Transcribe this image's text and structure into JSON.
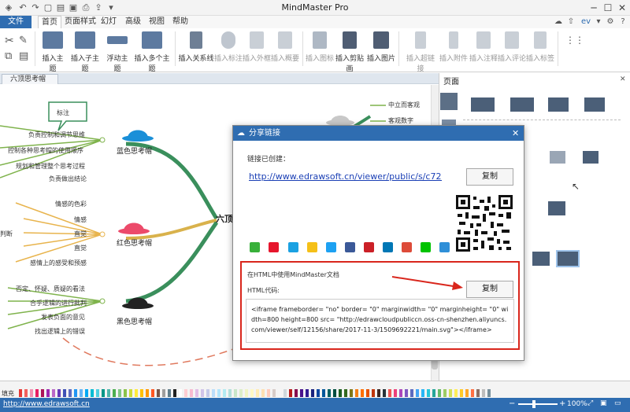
{
  "app": {
    "title": "MindMaster Pro",
    "account": "ev"
  },
  "menu": {
    "file": "文件",
    "tabs": [
      "首页",
      "页面样式",
      "幻灯片",
      "高级",
      "视图",
      "帮助"
    ]
  },
  "ribbon": {
    "buttons": [
      {
        "label": "插入主题"
      },
      {
        "label": "插入子主题"
      },
      {
        "label": "浮动主题"
      },
      {
        "label": "插入多个主题"
      },
      {
        "label": "插入关系线"
      },
      {
        "label": "插入标注"
      },
      {
        "label": "插入外框"
      },
      {
        "label": "插入概要"
      },
      {
        "label": "插入图标"
      },
      {
        "label": "插入剪贴画"
      },
      {
        "label": "插入图片"
      },
      {
        "label": "插入超链接"
      },
      {
        "label": "插入附件"
      },
      {
        "label": "插入注释"
      },
      {
        "label": "插入评论"
      },
      {
        "label": "插入标签"
      }
    ]
  },
  "document": {
    "tab_label": "六顶思考帽"
  },
  "mindmap": {
    "center": "六顶",
    "callout": "标注",
    "right_items": [
      "中立而客观",
      "客观数字"
    ],
    "blue_hat": {
      "label": "蓝色思考帽",
      "items": [
        "负责控制和调节思维",
        "控制各种思考帽的使用顺序",
        "规划和管理整个思考过程",
        "负责做出结论"
      ]
    },
    "red_hat": {
      "label": "红色思考帽",
      "side": "判断",
      "items": [
        "情感的色彩",
        "情感",
        "直觉",
        "直觉",
        "感情上的感受和预感"
      ]
    },
    "black_hat": {
      "label": "黑色思考帽",
      "items": [
        "否定、怀疑、质疑的看法",
        "合乎逻辑的进行批判",
        "发表负面的意见",
        "找出逻辑上的错误"
      ]
    }
  },
  "right_panel": {
    "title": "页面"
  },
  "palette": {
    "label": "填充",
    "colors": [
      "#e53935",
      "#f0605d",
      "#f48fb1",
      "#e91e63",
      "#ad1457",
      "#9c27b0",
      "#ba68c8",
      "#673ab7",
      "#3f51b5",
      "#5c6bc0",
      "#2196f3",
      "#64b5f6",
      "#03a9f4",
      "#00bcd4",
      "#4dd0e1",
      "#009688",
      "#4db6ac",
      "#4caf50",
      "#81c784",
      "#8bc34a",
      "#cddc39",
      "#ffeb3b",
      "#ffc107",
      "#ff9800",
      "#ff5722",
      "#795548",
      "#9e9e9e",
      "#607d8b",
      "#212121",
      "#ffffff",
      "#ffcdd2",
      "#f8bbd0",
      "#e1bee7",
      "#d1c4e9",
      "#c5cae9",
      "#bbdefb",
      "#b3e5fc",
      "#b2ebf2",
      "#b2dfdb",
      "#c8e6c9",
      "#dcedc8",
      "#f0f4c3",
      "#fff9c4",
      "#ffecb3",
      "#ffe0b2",
      "#ffccbc",
      "#d7ccc8",
      "#f5f5f5",
      "#cfd8dc",
      "#b71c1c",
      "#880e4f",
      "#4a148c",
      "#311b92",
      "#1a237e",
      "#0d47a1",
      "#01579b",
      "#006064",
      "#004d40",
      "#1b5e20",
      "#33691e",
      "#827717",
      "#f57f17",
      "#ff6f00",
      "#e65100",
      "#bf360c",
      "#3e2723",
      "#263238",
      "#ef5350",
      "#ec407a",
      "#ab47bc",
      "#7e57c2",
      "#5c6bc0",
      "#42a5f5",
      "#29b6f6",
      "#26c6da",
      "#26a69a",
      "#66bb6a",
      "#9ccc65",
      "#d4e157",
      "#ffee58",
      "#ffca28",
      "#ffa726",
      "#ff7043",
      "#8d6e63",
      "#bdbdbd",
      "#78909c"
    ]
  },
  "status": {
    "link": "http://www.edrawsoft.cn",
    "zoom": "100%"
  },
  "dialog": {
    "title": "分享链接",
    "link_created_label": "链接已创建：",
    "share_url": "http://www.edrawsoft.cn/viewer/public/s/c72d709497950",
    "copy_label": "复制",
    "share_icons": [
      "wechat-icon",
      "weibo-icon",
      "qq-icon",
      "qzone-icon",
      "twitter-icon",
      "facebook-icon",
      "pinterest-icon",
      "linkedin-icon",
      "googleplus-icon",
      "line-icon",
      "email-icon"
    ],
    "html_section_title": "在HTML中使用MindMaster文档",
    "html_code_label": "HTML代码:",
    "html_copy_label": "复制",
    "html_code": "<iframe frameborder= \"no\" border= \"0\" marginwidth= \"0\" marginheight= \"0\" width=800 height=800 src= \"http://edrawcloudpubliccn.oss-cn-shenzhen.aliyuncs.com/viewer/self/12156/share/2017-11-3/1509692221/main.svg\"></iframe>"
  }
}
